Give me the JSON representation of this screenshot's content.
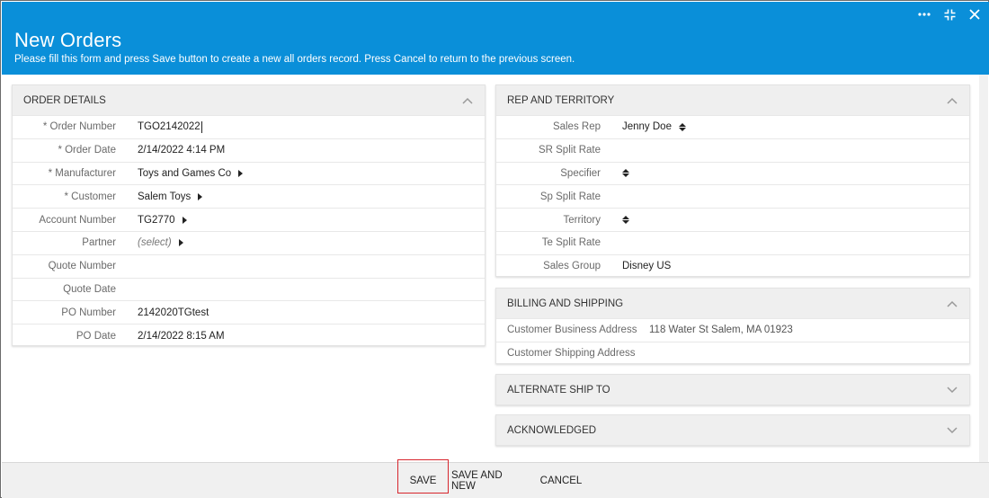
{
  "header": {
    "title": "New Orders",
    "subtitle": "Please fill this form and press Save button to create a new all orders record. Press Cancel to return to the previous screen.",
    "icons": [
      "more-icon",
      "collapse-icon",
      "close-icon"
    ],
    "color": "#0a8fd9"
  },
  "order_details": {
    "title": "ORDER DETAILS",
    "fields": [
      {
        "label": "* Order Number",
        "value": "TGO2142022"
      },
      {
        "label": "* Order Date",
        "value": "2/14/2022 4:14 PM"
      },
      {
        "label": "* Manufacturer",
        "value": "Toys and Games Co"
      },
      {
        "label": "* Customer",
        "value": "Salem Toys"
      },
      {
        "label": "Account Number",
        "value": "TG2770"
      },
      {
        "label": "Partner",
        "value": "(select)"
      },
      {
        "label": "Quote Number",
        "value": ""
      },
      {
        "label": "Quote Date",
        "value": ""
      },
      {
        "label": "PO Number",
        "value": "2142020TGtest"
      },
      {
        "label": "PO Date",
        "value": "2/14/2022 8:15 AM"
      }
    ]
  },
  "rep_territory": {
    "title": "REP AND TERRITORY",
    "fields": [
      {
        "label": "Sales Rep",
        "value": "Jenny Doe"
      },
      {
        "label": "SR Split Rate",
        "value": ""
      },
      {
        "label": "Specifier",
        "value": ""
      },
      {
        "label": "Sp Split Rate",
        "value": ""
      },
      {
        "label": "Territory",
        "value": ""
      },
      {
        "label": "Te Split Rate",
        "value": ""
      },
      {
        "label": "Sales Group",
        "value": "Disney US"
      }
    ]
  },
  "billing_shipping": {
    "title": "BILLING AND SHIPPING",
    "fields": [
      {
        "label": "Customer Business Address",
        "value": "118 Water St Salem, MA 01923"
      },
      {
        "label": "Customer Shipping Address",
        "value": ""
      }
    ]
  },
  "alternate_ship": {
    "title": "ALTERNATE SHIP TO"
  },
  "acknowledged": {
    "title": "ACKNOWLEDGED"
  },
  "footer": {
    "save_label": "SAVE",
    "save_new_label": "SAVE AND NEW",
    "cancel_label": "CANCEL",
    "highlight_color": "#d7262d"
  }
}
